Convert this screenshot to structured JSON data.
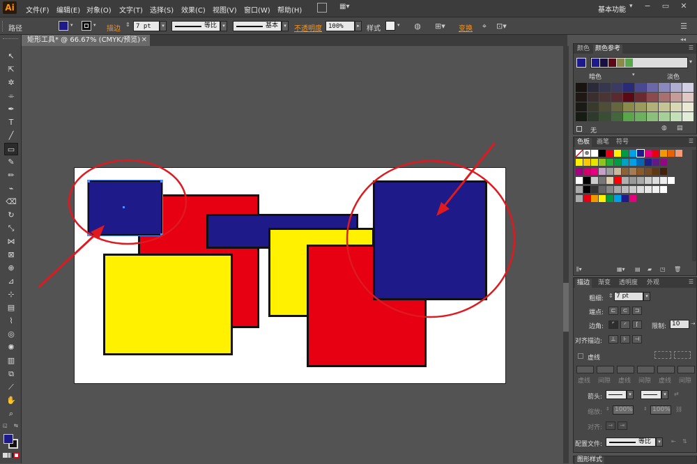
{
  "app": {
    "logo": "Ai",
    "workspace": "基本功能",
    "minimize": "−",
    "restore": "▭",
    "close": "✕"
  },
  "menu": [
    "文件(F)",
    "编辑(E)",
    "对象(O)",
    "文字(T)",
    "选择(S)",
    "效果(C)",
    "视图(V)",
    "窗口(W)",
    "帮助(H)"
  ],
  "control": {
    "type_label": "路径",
    "stroke_label": "描边",
    "stroke_value": "7 pt",
    "profile_label": "等比",
    "brush_label": "基本",
    "opacity_label": "不透明度",
    "opacity_value": "100%",
    "style_label": "样式",
    "transform_label": "变换",
    "fill_color": "#1f1a8a"
  },
  "document": {
    "tab_title": "矩形工具* @ 66.67% (CMYK/预览)"
  },
  "colors": {
    "blue": "#1f1a8a",
    "red": "#e60012",
    "yellow": "#fff100",
    "annotation": "#e0191e"
  },
  "color_panel": {
    "tabs": [
      "颜色",
      "颜色参考"
    ],
    "dark_label": "暗色",
    "light_label": "淡色",
    "none_label": "无"
  },
  "swatch_panel": {
    "tabs": [
      "色板",
      "画笔",
      "符号"
    ]
  },
  "stroke_panel": {
    "tabs": [
      "描边",
      "渐变",
      "透明度",
      "外观"
    ],
    "weight_label": "粗细:",
    "weight_value": "7 pt",
    "cap_label": "端点:",
    "corner_label": "边角:",
    "limit_label": "限制:",
    "limit_value": "10",
    "align_label": "对齐描边:",
    "dashed_label": "虚线",
    "dash_labels": [
      "虚线",
      "间隙",
      "虚线",
      "间隙",
      "虚线",
      "间隙"
    ],
    "arrow_label": "箭头:",
    "scale_label": "缩放:",
    "scale_value1": "100%",
    "scale_value2": "100%",
    "align2_label": "对齐:",
    "profile_label": "配置文件:",
    "profile_value": "等比"
  },
  "bottom_panel": {
    "tab": "图形样式"
  }
}
